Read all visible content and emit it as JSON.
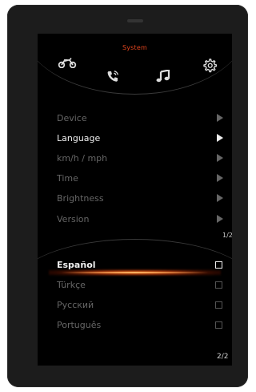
{
  "header": {
    "title": "System"
  },
  "tabs": [
    {
      "icon": "motorcycle-icon",
      "active": false
    },
    {
      "icon": "phone-icon",
      "active": false
    },
    {
      "icon": "music-note-icon",
      "active": false
    },
    {
      "icon": "gear-icon",
      "active": true
    }
  ],
  "menu": {
    "items": [
      {
        "label": "Device",
        "active": false
      },
      {
        "label": "Language",
        "active": true
      },
      {
        "label": "km/h / mph",
        "active": false
      },
      {
        "label": "Time",
        "active": false
      },
      {
        "label": "Brightness",
        "active": false
      },
      {
        "label": "Version",
        "active": false
      }
    ],
    "page": "1/2"
  },
  "languages": {
    "items": [
      {
        "label": "Español",
        "checked": false,
        "highlighted": true
      },
      {
        "label": "Türkçe",
        "checked": false,
        "highlighted": false
      },
      {
        "label": "Русский",
        "checked": false,
        "highlighted": false
      },
      {
        "label": "Português",
        "checked": false,
        "highlighted": false
      }
    ],
    "page": "2/2"
  },
  "colors": {
    "accent": "#e2451e",
    "text_active": "#f0f0f0",
    "text_inactive": "#666666",
    "highlight_glow": "#ff8c28"
  }
}
